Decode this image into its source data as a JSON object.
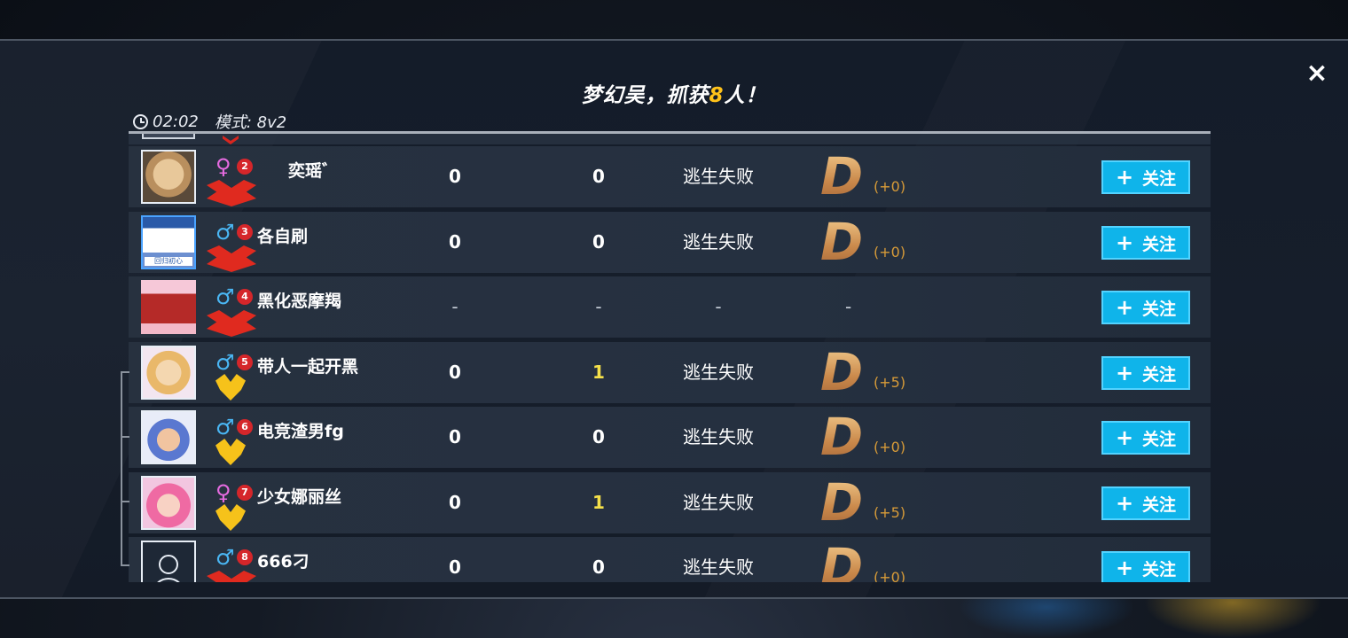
{
  "title": {
    "prefix": "梦幻吴，抓获",
    "count": "8",
    "suffix": "人！"
  },
  "meta": {
    "time": "02:02",
    "mode": "模式: 8v2"
  },
  "close_label": "×",
  "follow_label": "关注",
  "follow_icon": "+",
  "icons": {
    "clock": "clock-icon",
    "close": "close-icon",
    "plus": "plus-icon",
    "male": "male-icon",
    "female": "female-icon"
  },
  "colors": {
    "accent": "#0fb4ea",
    "highlight": "#ffc21a",
    "grade": "#d59a57",
    "rank_badge": "#d5262a"
  },
  "players": [
    {
      "rank": "2",
      "gender": "♀",
      "name": "奕瑶゛",
      "stat1": "0",
      "stat2": "0",
      "result": "逃生失败",
      "grade": "D",
      "delta": "(+0)"
    },
    {
      "rank": "3",
      "gender": "♂",
      "name": "各自刷",
      "avatar_tag": "回归初心",
      "stat1": "0",
      "stat2": "0",
      "result": "逃生失败",
      "grade": "D",
      "delta": "(+0)"
    },
    {
      "rank": "4",
      "gender": "♂",
      "name": "黑化恶摩羯",
      "stat1": "-",
      "stat2": "-",
      "result": "-",
      "grade": "-"
    },
    {
      "rank": "5",
      "gender": "♂",
      "name": "带人一起开黑",
      "stat1": "0",
      "stat2": "1",
      "result": "逃生失败",
      "grade": "D",
      "delta": "(+5)"
    },
    {
      "rank": "6",
      "gender": "♂",
      "name": "电竞渣男fg",
      "stat1": "0",
      "stat2": "0",
      "result": "逃生失败",
      "grade": "D",
      "delta": "(+0)"
    },
    {
      "rank": "7",
      "gender": "♀",
      "name": "少女娜丽丝",
      "stat1": "0",
      "stat2": "1",
      "result": "逃生失败",
      "grade": "D",
      "delta": "(+5)"
    },
    {
      "rank": "8",
      "gender": "♂",
      "name": "666刁",
      "stat1": "0",
      "stat2": "0",
      "result": "逃生失败",
      "grade": "D",
      "delta": "(+0)"
    }
  ]
}
